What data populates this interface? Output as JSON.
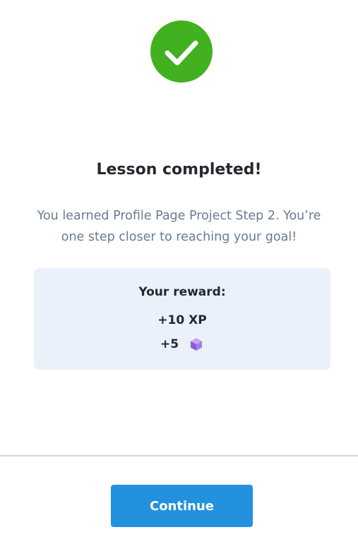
{
  "header": {
    "icon": "checkmark-icon",
    "icon_color": "#42b120"
  },
  "main": {
    "title": "Lesson completed!",
    "subtitle": "You learned Profile Page Project Step 2. You’re one step closer to reaching your goal!"
  },
  "reward": {
    "title": "Your reward:",
    "xp": "+10 XP",
    "gems": "+5",
    "gem_icon": "purple-cube-icon",
    "background": "#ebf1fb"
  },
  "footer": {
    "continue_label": "Continue",
    "button_color": "#2491df"
  }
}
